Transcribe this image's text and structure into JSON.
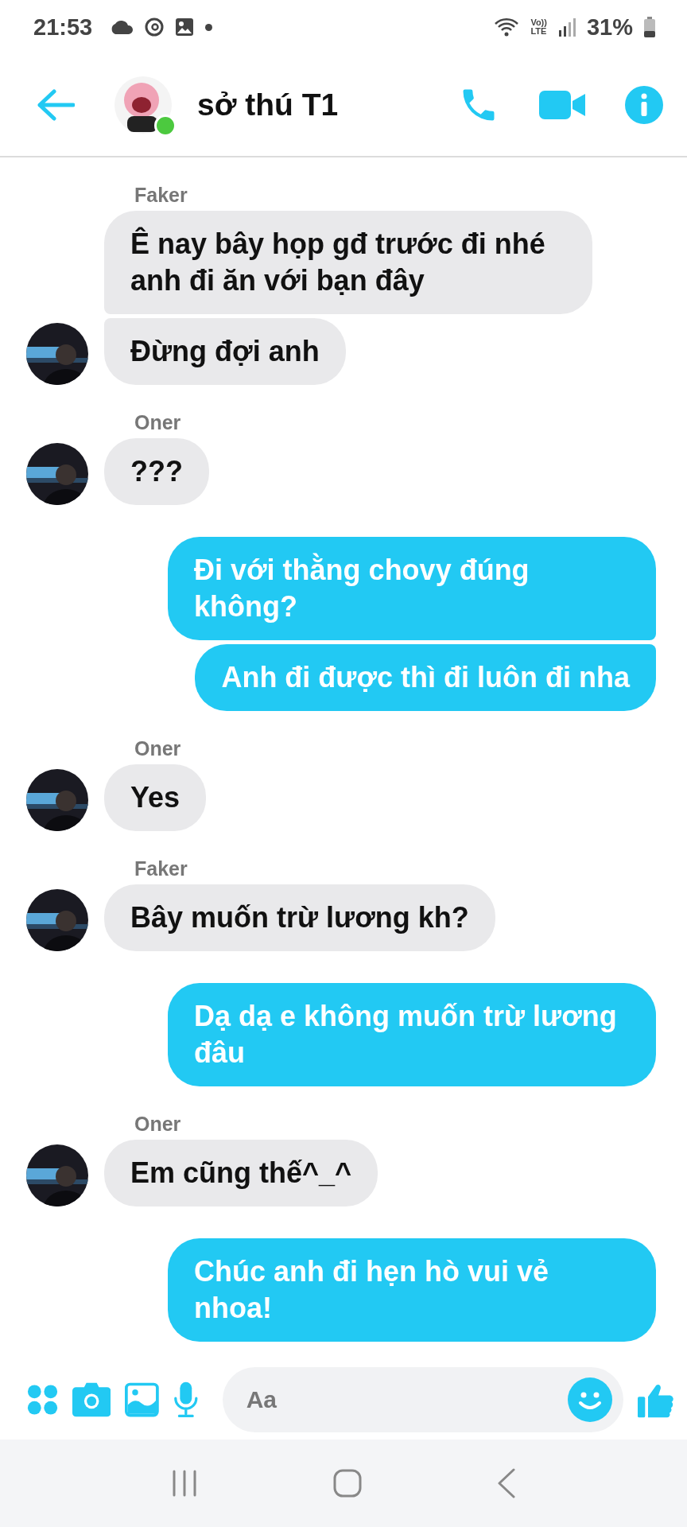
{
  "status_bar": {
    "time": "21:53",
    "network_top": "Vo))",
    "network_bottom": "LTE",
    "battery": "31%"
  },
  "header": {
    "title": "sở thú T1",
    "online": true
  },
  "groups": [
    {
      "kind": "incoming",
      "sender": "Faker",
      "texts": [
        "Ê nay bây họp gđ trước đi nhé anh đi ăn với bạn đây",
        "Đừng đợi anh"
      ]
    },
    {
      "kind": "incoming",
      "sender": "Oner",
      "texts": [
        "???"
      ]
    },
    {
      "kind": "outgoing",
      "texts": [
        "Đi với thằng chovy đúng không?",
        "Anh đi được thì đi luôn đi nha"
      ]
    },
    {
      "kind": "incoming",
      "sender": "Oner",
      "texts": [
        "Yes"
      ]
    },
    {
      "kind": "incoming",
      "sender": "Faker",
      "texts": [
        "Bây muốn trừ lương kh?"
      ]
    },
    {
      "kind": "outgoing",
      "texts": [
        "Dạ dạ e không muốn trừ lương đâu"
      ]
    },
    {
      "kind": "incoming",
      "sender": "Oner",
      "texts": [
        "Em cũng thế^_^"
      ]
    },
    {
      "kind": "outgoing",
      "texts": [
        "Chúc anh đi hẹn hò vui vẻ nhoa!"
      ]
    }
  ],
  "composer": {
    "placeholder": "Aa"
  }
}
